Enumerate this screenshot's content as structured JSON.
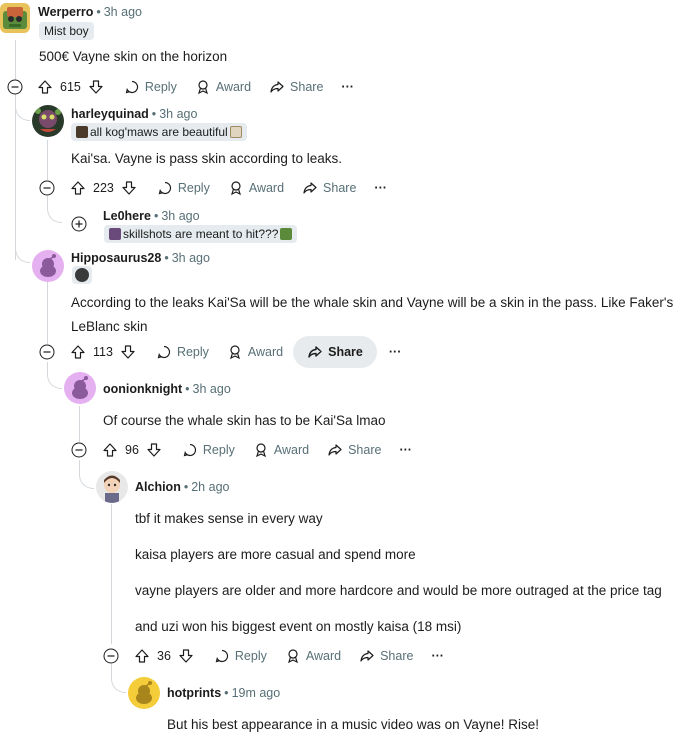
{
  "colors": {
    "meta": "#576f76",
    "thread_line": "#d4d8dc",
    "flair_bg": "#e5ebee",
    "share_hover": "#e8ebed"
  },
  "comments": [
    {
      "author": "Werperro",
      "time": "3h ago",
      "flair": "Mist boy",
      "body": [
        "500€ Vayne skin on the horizon"
      ],
      "score": "615"
    },
    {
      "author": "harleyquinad",
      "time": "3h ago",
      "flair": "all kog'maws are beautiful",
      "body": [
        "Kai'sa. Vayne is pass skin according to leaks."
      ],
      "score": "223"
    },
    {
      "author": "Le0here",
      "time": "3h ago",
      "flair": "skillshots are meant to hit???"
    },
    {
      "author": "Hipposaurus28",
      "time": "3h ago",
      "flair": "",
      "body": [
        "According to the leaks Kai'Sa will be the whale skin and Vayne will be a skin in the pass. Like Faker's",
        "LeBlanc skin"
      ],
      "score": "113"
    },
    {
      "author": "oonionknight",
      "time": "3h ago",
      "body": [
        "Of course the whale skin has to be Kai'Sa lmao"
      ],
      "score": "96"
    },
    {
      "author": "Alchion",
      "time": "2h ago",
      "body": [
        "tbf it makes sense in every way",
        "kaisa players are more casual and spend more",
        "vayne players are older and more hardcore and would be more outraged at the price tag",
        "and uzi won his biggest event on mostly kaisa (18 msi)"
      ],
      "score": "36"
    },
    {
      "author": "hotprints",
      "time": "19m ago",
      "body": [
        "But his best appearance in a music video was on Vayne! Rise!"
      ]
    }
  ],
  "actions": {
    "reply": "Reply",
    "award": "Award",
    "share": "Share",
    "more": "···"
  },
  "dot": "•"
}
